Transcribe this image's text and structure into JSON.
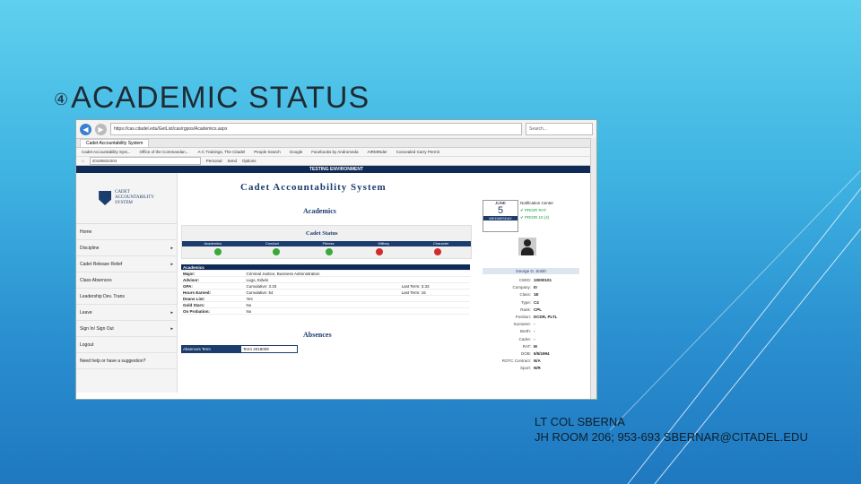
{
  "slide": {
    "title": "ACADEMIC STATUS",
    "bullet": "④",
    "footer_line1": "LT COL SBERNA",
    "footer_line2": "JH ROOM 206; 953-693 SBERNAR@CITADEL.EDU"
  },
  "browser": {
    "address": "https://cas.citadel.edu/GetList/cas/rgpos/Academics.aspx",
    "search_placeholder": "Search...",
    "tab_label": "Cadet Accountability System",
    "favorites": [
      "Cadet Accountability Syst...",
      "Office of the Commandan...",
      "A-C Trainings, The Citadel",
      "People Search",
      "Google",
      "Facebooks by Andromeda",
      "AIRMINder",
      "Concealed Carry Permit"
    ],
    "tool_field": "20180831004",
    "tool_personal": "Personal",
    "tool_send": "Send",
    "tool_options": "Options"
  },
  "app": {
    "test_banner": "TESTING ENVIRONMENT",
    "title": "Cadet Accountability System",
    "logo_lines": [
      "CADET",
      "ACCOUNTABILITY",
      "SYSTEM"
    ],
    "sidebar": [
      "Home",
      "Discipline",
      "Cadet Release Relief",
      "Class Absences",
      "Leadership Dev. Trans",
      "Leave",
      "Sign In/ Sign Out",
      "Logout",
      "Need help or have a suggestion?"
    ],
    "academics_heading": "Academics",
    "status_heading": "Cadet Status",
    "status_columns": [
      "Academics",
      "Conduct",
      "Fitness",
      "Military",
      "Character"
    ],
    "status_colors": [
      "#3aa83a",
      "#3aa83a",
      "#3aa83a",
      "#d42a2a",
      "#d42a2a"
    ],
    "academic_table_head": "Academics",
    "academic_rows": [
      [
        "Major:",
        "Criminal Justice, Business Administration",
        "",
        ""
      ],
      [
        "Advisor:",
        "Lugo, Edwin",
        "",
        ""
      ],
      [
        "GPA:",
        "Cumulative: 3.33",
        "Last Term: 3.33",
        ""
      ],
      [
        "Hours Earned:",
        "Cumulative: 54",
        "Last Term: 15",
        ""
      ],
      [
        "Deans List:",
        "Yes",
        "",
        ""
      ],
      [
        "Gold Stars:",
        "No",
        "",
        ""
      ],
      [
        "On Probation:",
        "No",
        "",
        ""
      ]
    ],
    "absences_heading": "Absences",
    "absences_label": "Absences Term",
    "absences_value": "Term 2018009",
    "calendar_month": "JUNE",
    "calendar_day": "5",
    "calendar_weekday": "WEDNESDAY",
    "verify_title": "Notification Center",
    "verify_items": [
      "✔ PRIOR RAT",
      "✔ PRIOR 10 (4)"
    ],
    "profile_name": "George G. Smith",
    "profile_rows": [
      [
        "CWID:",
        "10000101"
      ],
      [
        "Company:",
        "I0"
      ],
      [
        "Class:",
        "1E"
      ],
      [
        "Type:",
        "C4"
      ],
      [
        "Rank:",
        "CPL"
      ],
      [
        "Position:",
        "DCDR, PLTL"
      ],
      [
        "Surname:",
        "-"
      ],
      [
        "Berth:",
        "-"
      ],
      [
        "Cadre:",
        "-"
      ],
      [
        "RAT:",
        "M"
      ],
      [
        "DOB:",
        "5/5/1994"
      ],
      [
        "ROTC Contract:",
        "N/A"
      ],
      [
        "Sport:",
        "N/R"
      ]
    ]
  }
}
